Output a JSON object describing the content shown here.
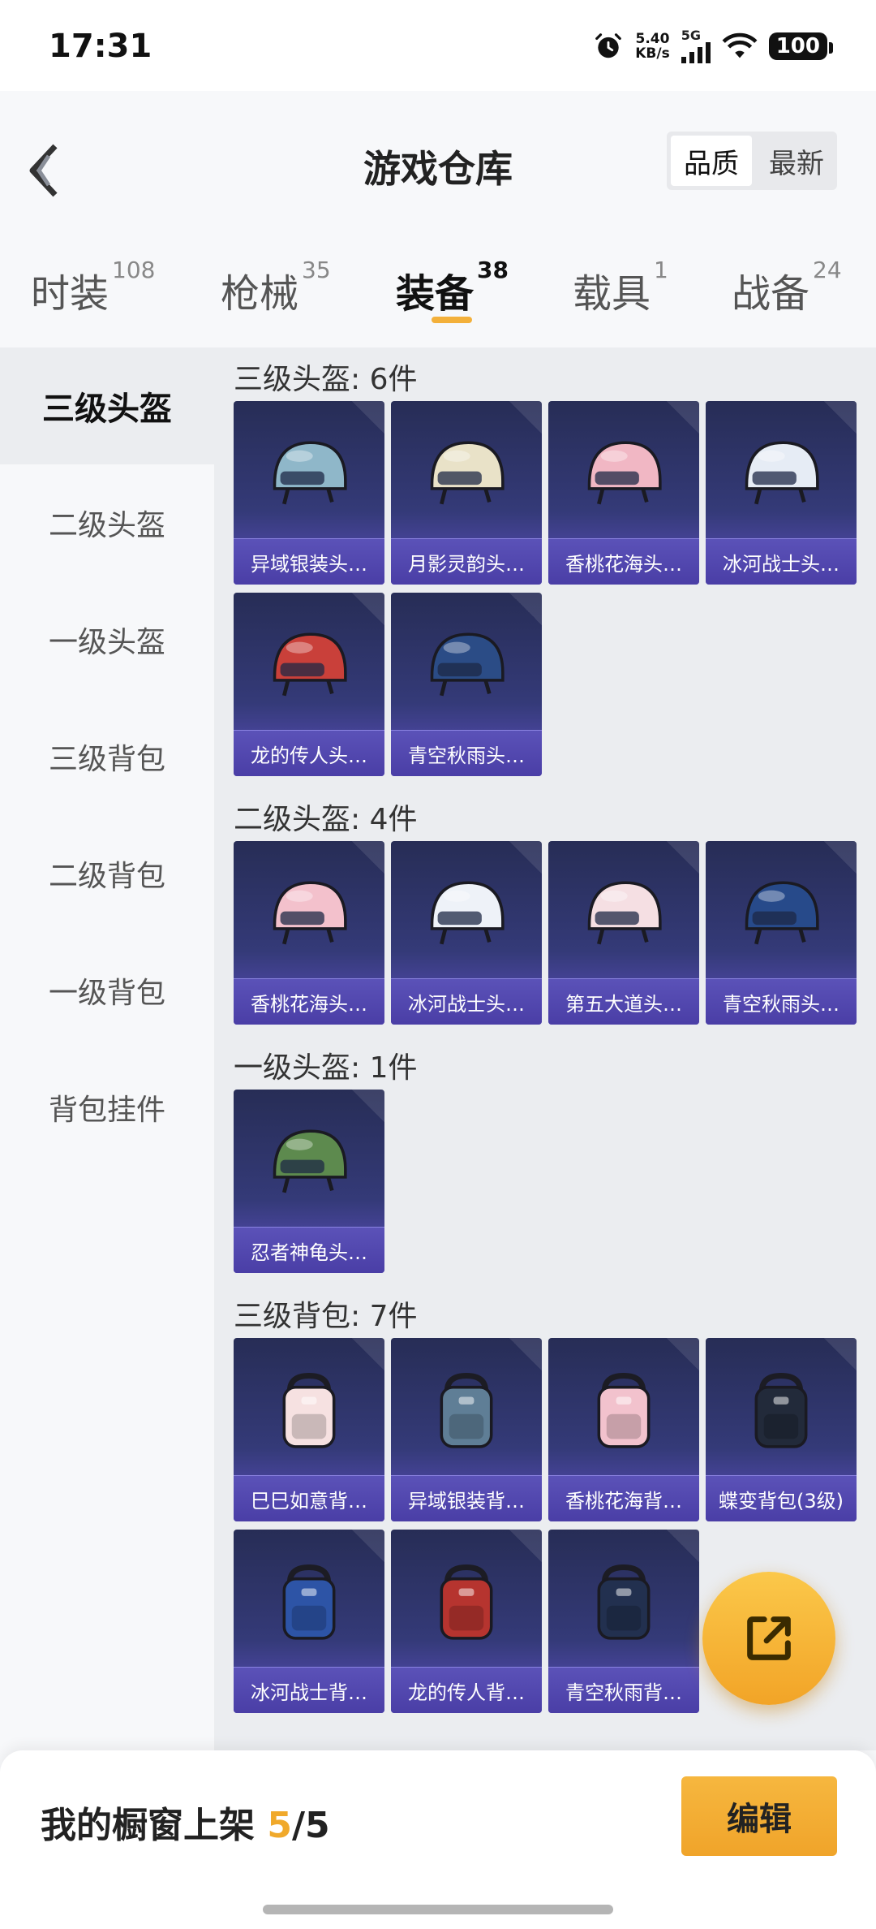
{
  "status_bar": {
    "time": "17:31",
    "net_speed_value": "5.40",
    "net_speed_unit": "KB/s",
    "network": "5G",
    "battery": "100"
  },
  "header": {
    "title": "游戏仓库",
    "sort_options": [
      "品质",
      "最新"
    ],
    "sort_active": "品质"
  },
  "tabs": [
    {
      "label": "时装",
      "count": "108"
    },
    {
      "label": "枪械",
      "count": "35"
    },
    {
      "label": "装备",
      "count": "38"
    },
    {
      "label": "载具",
      "count": "1"
    },
    {
      "label": "战备",
      "count": "24"
    }
  ],
  "active_tab": "装备",
  "sidebar": {
    "items": [
      "三级头盔",
      "二级头盔",
      "一级头盔",
      "三级背包",
      "二级背包",
      "一级背包",
      "背包挂件"
    ],
    "active": "三级头盔"
  },
  "sections": [
    {
      "title": "三级头盔: 6件",
      "items": [
        {
          "name": "异域银装头…",
          "icon": "helmet-icon",
          "color": "#8fb7c9"
        },
        {
          "name": "月影灵韵头…",
          "icon": "helmet-icon",
          "color": "#e9e2c8"
        },
        {
          "name": "香桃花海头…",
          "icon": "helmet-icon",
          "color": "#f1b7c4"
        },
        {
          "name": "冰河战士头…",
          "icon": "helmet-icon",
          "color": "#e6ecf5"
        },
        {
          "name": "龙的传人头…",
          "icon": "helmet-icon",
          "color": "#c9403a"
        },
        {
          "name": "青空秋雨头…",
          "icon": "helmet-icon",
          "color": "#2b4c86"
        }
      ]
    },
    {
      "title": "二级头盔: 4件",
      "items": [
        {
          "name": "香桃花海头…",
          "icon": "helmet-icon",
          "color": "#f3c1cc"
        },
        {
          "name": "冰河战士头…",
          "icon": "helmet-icon",
          "color": "#eef2f8"
        },
        {
          "name": "第五大道头…",
          "icon": "helmet-icon",
          "color": "#f5dfe3"
        },
        {
          "name": "青空秋雨头…",
          "icon": "helmet-icon",
          "color": "#274a8a"
        }
      ]
    },
    {
      "title": "一级头盔: 1件",
      "items": [
        {
          "name": "忍者神龟头…",
          "icon": "helmet-icon",
          "color": "#5d8a4e"
        }
      ]
    },
    {
      "title": "三级背包: 7件",
      "items": [
        {
          "name": "巳巳如意背…",
          "icon": "backpack-icon",
          "color": "#f6e1e1"
        },
        {
          "name": "异域银装背…",
          "icon": "backpack-icon",
          "color": "#5f7e96"
        },
        {
          "name": "香桃花海背…",
          "icon": "backpack-icon",
          "color": "#f2c2cd"
        },
        {
          "name": "蝶变背包(3级)",
          "icon": "backpack-icon",
          "color": "#222a3a"
        },
        {
          "name": "冰河战士背…",
          "icon": "backpack-icon",
          "color": "#2d54a6"
        },
        {
          "name": "龙的传人背…",
          "icon": "backpack-icon",
          "color": "#b6342f"
        },
        {
          "name": "青空秋雨背…",
          "icon": "backpack-icon",
          "color": "#22304f"
        }
      ]
    }
  ],
  "bottom_bar": {
    "label": "我的橱窗上架",
    "count_current": "5",
    "count_separator": "/",
    "count_total": "5",
    "edit_label": "编辑"
  },
  "colors": {
    "accent": "#f3b03a",
    "card": "#343a78"
  }
}
